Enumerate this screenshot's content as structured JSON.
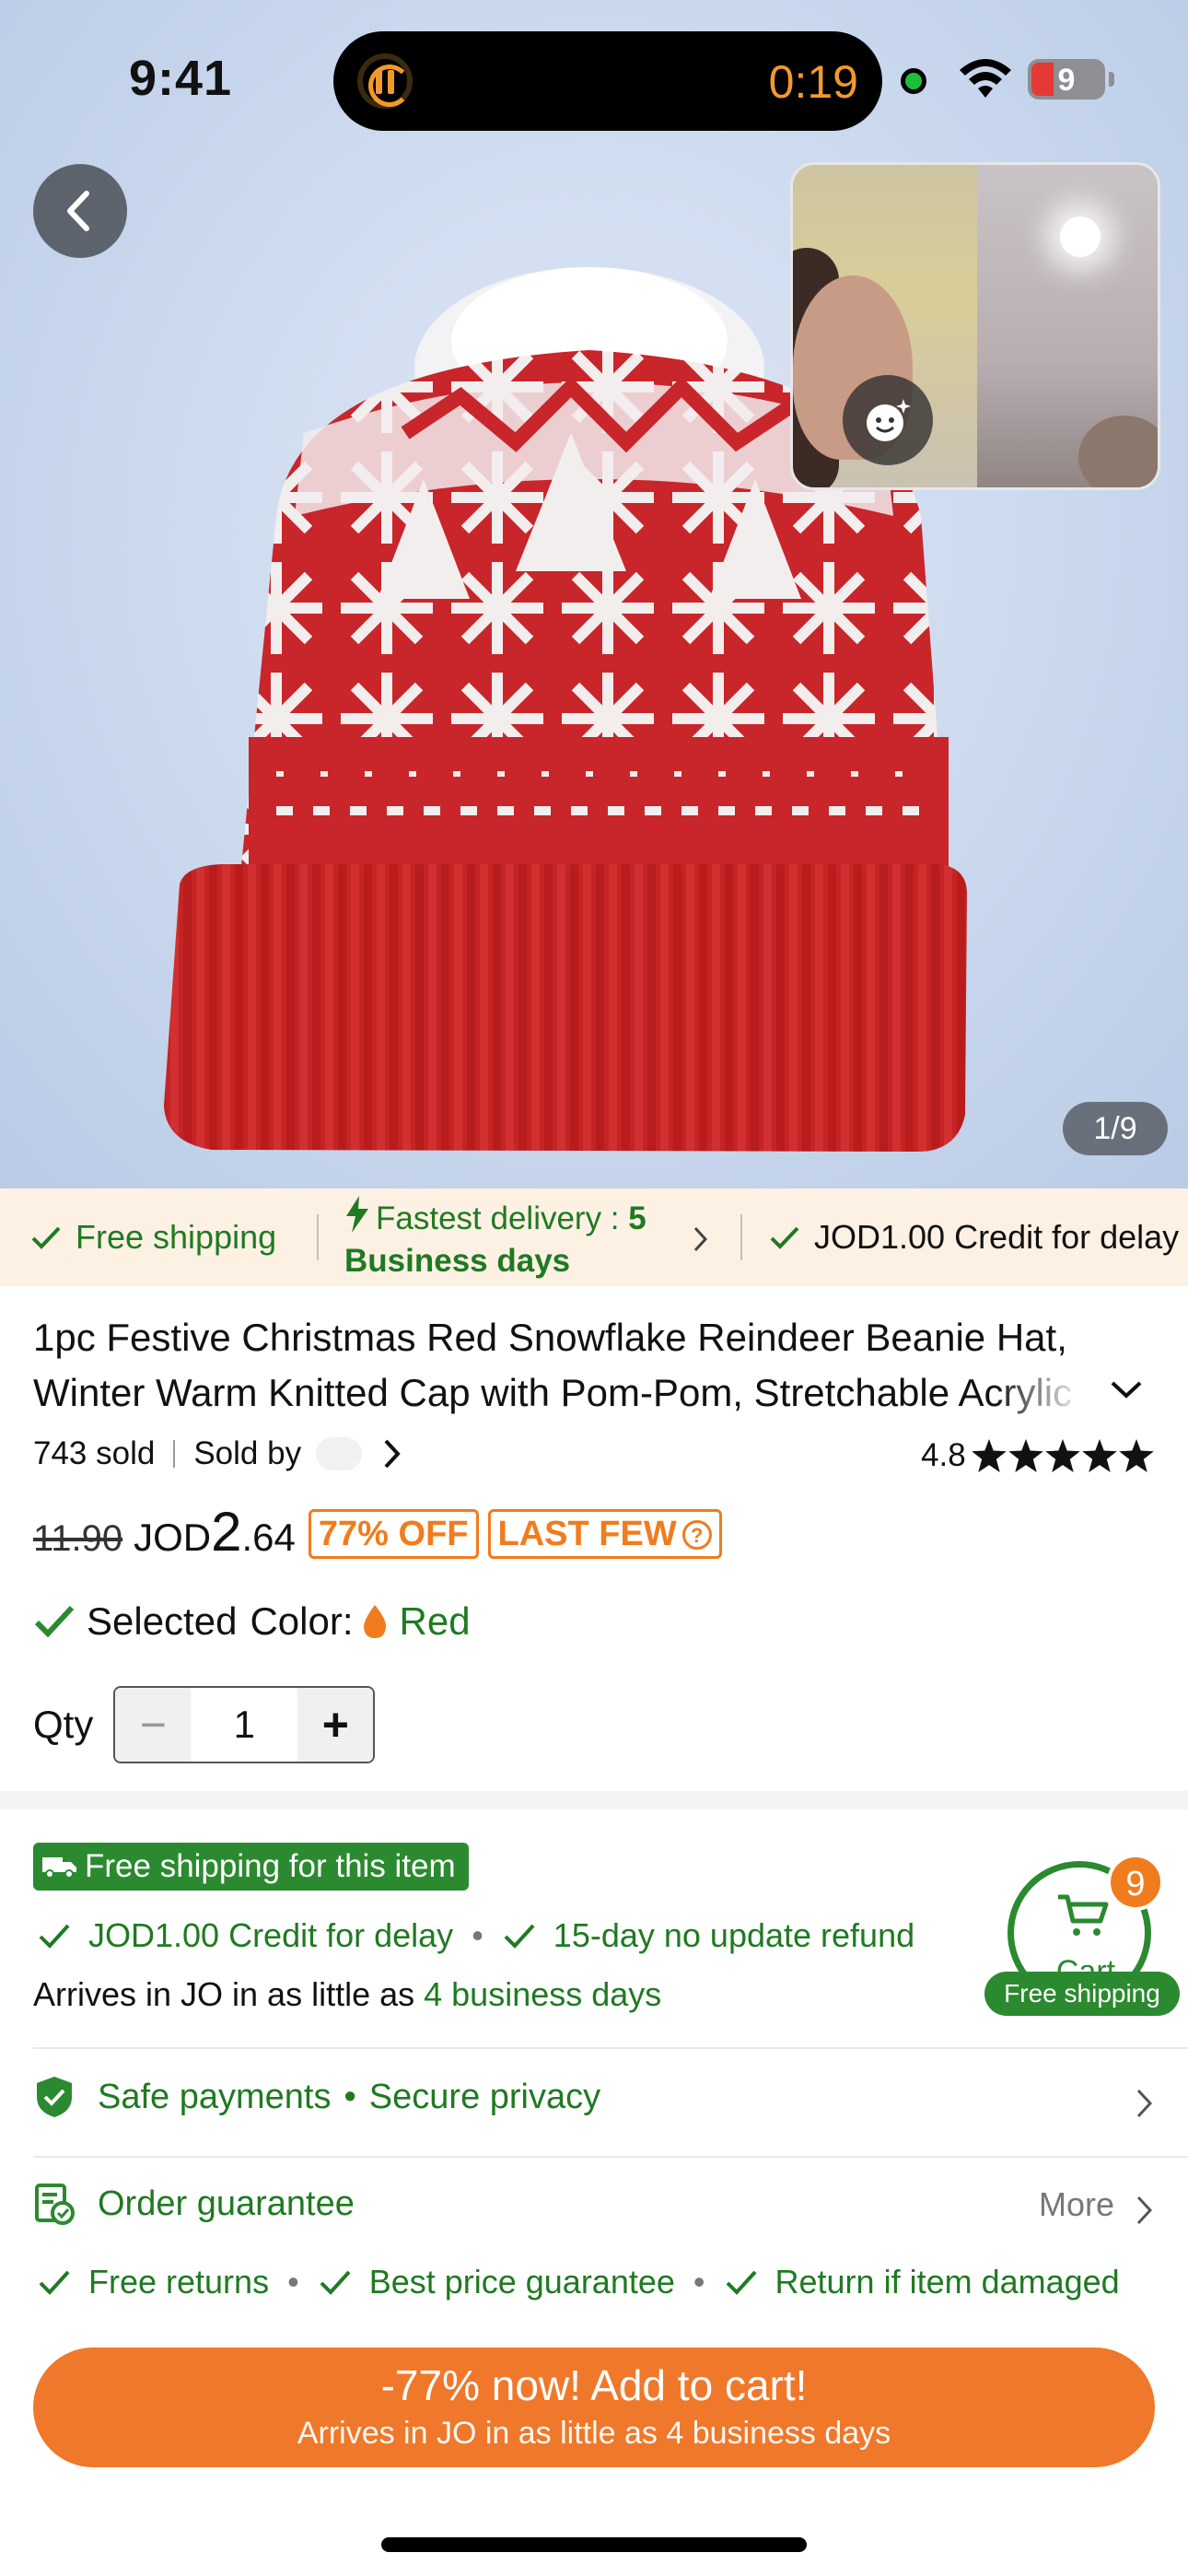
{
  "status_bar": {
    "time": "9:41",
    "recording_timer": "0:19",
    "battery_level": "9"
  },
  "product_image": {
    "counter": "1/9",
    "icons": [
      "back-chevron-icon",
      "face-effects-icon"
    ]
  },
  "shipping_strip": {
    "free_shipping": "Free shipping",
    "fastest_delivery_line1": "Fastest delivery : ",
    "fastest_delivery_days": "5",
    "fastest_delivery_line2": "Business days",
    "credit_for_delay": "JOD1.00 Credit for delay"
  },
  "product": {
    "title": "1pc Festive Christmas Red Snowflake Reindeer Beanie Hat, Winter Warm Knitted Cap with Pom-Pom, Stretchable Acrylic",
    "sold_count": "743 sold",
    "sold_by_label": "Sold by",
    "rating": "4.8",
    "stars": 5,
    "old_price": "11.90",
    "currency": "JOD",
    "price_integer": "2",
    "price_decimal": ".64",
    "discount_badge": "77% OFF",
    "stock_badge": "LAST FEW",
    "selected_label": "Selected",
    "color_label": "Color:",
    "color_value": "Red",
    "qty_label": "Qty",
    "qty_value": "1",
    "qty_minus": "−",
    "qty_plus": "+"
  },
  "shipping_section": {
    "free_tag": "Free shipping for this item",
    "perk_credit": "JOD1.00 Credit for delay",
    "perk_refund": "15-day no update refund",
    "arrive_prefix": "Arrives in JO in as little as ",
    "arrive_days": "4 business days"
  },
  "cart_float": {
    "label": "Cart",
    "count": "9",
    "free_shipping": "Free shipping"
  },
  "trust": {
    "safe_payments": "Safe payments",
    "separator": "•",
    "secure_privacy": "Secure privacy",
    "order_guarantee": "Order guarantee",
    "more": "More",
    "free_returns": "Free returns",
    "best_price": "Best price guarantee",
    "return_damaged": "Return if item damaged"
  },
  "cta": {
    "line1": "-77% now! Add to cart!",
    "line2": "Arrives in JO in as little as 4 business days"
  },
  "colors": {
    "accent_orange": "#f07c1e",
    "green": "#1f7a22",
    "strip_bg": "#fdf1e4"
  }
}
